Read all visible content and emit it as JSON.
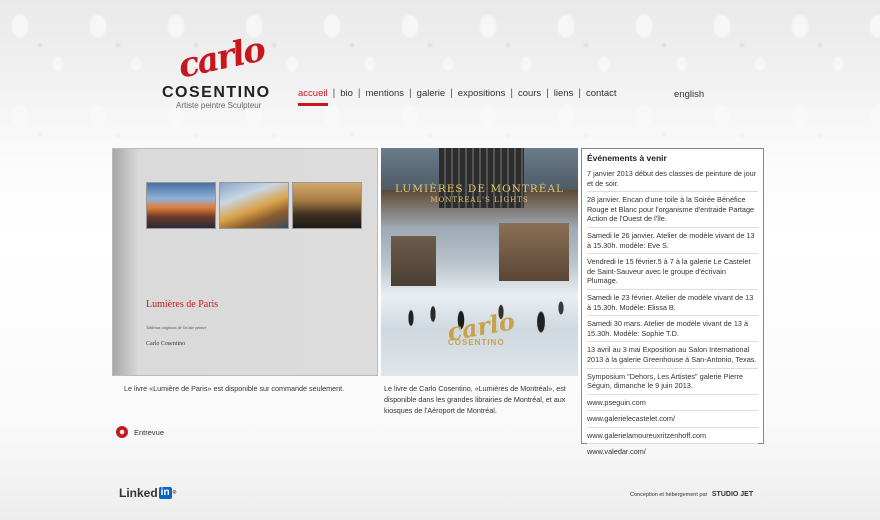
{
  "logo": {
    "script": "carlo",
    "name": "COSENTINO",
    "subtitle": "Artiste peintre Sculpteur"
  },
  "nav": {
    "items": [
      {
        "label": "accueil",
        "active": true
      },
      {
        "label": "bio"
      },
      {
        "label": "mentions"
      },
      {
        "label": "galerie"
      },
      {
        "label": "expositions"
      },
      {
        "label": "cours"
      },
      {
        "label": "liens"
      },
      {
        "label": "contact"
      }
    ],
    "language": "english"
  },
  "book_paris": {
    "title": "Lumières de Paris",
    "subtitle": "Tableaux originaux de l'artiste peintre",
    "author": "Carlo Cosentino",
    "caption": "Le livre «Lumière de Paris» est disponible sur commande seulement."
  },
  "book_montreal": {
    "title": "LUMIÈRES DE MONTRÉAL",
    "subtitle": "MONTREAL'S LIGHTS",
    "logo_script": "carlo",
    "logo_name": "COSENTINO",
    "caption": "Le livre de Carlo Cosentino, «Lumières de Montréal», est disponible dans les grandes librairies de Montréal, et aux kiosques de l'Aéroport de Montréal."
  },
  "interview": {
    "label": "Entrevue"
  },
  "events": {
    "title": "Événements à venir",
    "items": [
      "7 janvier 2013 début des classes de peinture de jour et de soir.",
      "28 janvier. Encan d'une toile à la Soirée Bénéfice Rouge et Blanc pour l'organisme d'entraide Partage Action de l'Ouest de l'île.",
      "Samedi le 26 janvier. Atelier de modèle vivant de 13 à 15.30h. modèle: Eve S.",
      "Vendredi le 15 février.5 à 7 à la galerie Le Castelet de Saint-Sauveur avec le groupe d'écrivain Plumage.",
      "Samedi le 23 février. Atelier de modèle vivant de 13 à 15.30h. Modèle: Elissa B.",
      "Samedi 30 mars. Atelier de modèle vivant de 13 à 15.30h. Modèle: Sophie T.D.",
      "13 avril au 3 mai  Exposition au Salon International 2013 à la galerie Greenhouse à San-Antonio, Texas.",
      "Symposium \"Dehors, Les Artistes\" galerie Pierre Séguin, dimanche le 9 juin 2013."
    ],
    "links": [
      "www.pseguin.com",
      "www.galerielecastelet.com/",
      "www.galerielamoureuxritzenhoff.com",
      "www.valedar.com/"
    ]
  },
  "footer": {
    "linkedin_text": "Linked",
    "linkedin_box": "in",
    "linkedin_reg": "®",
    "credit": "Conception et hébergement par",
    "credit_brand": "STUDIO JET"
  }
}
